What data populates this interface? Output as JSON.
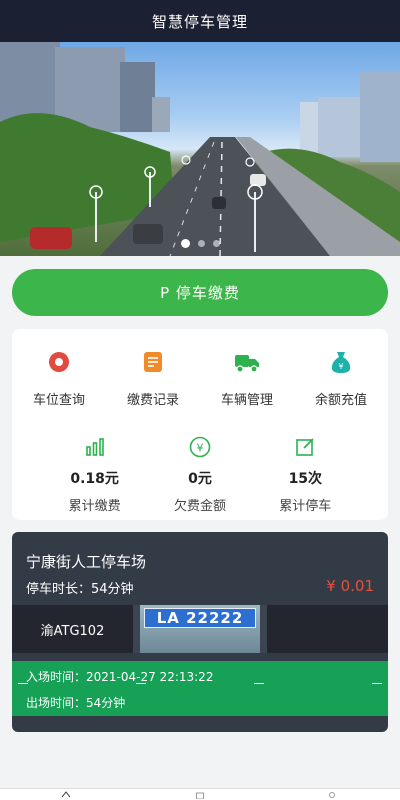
{
  "header": {
    "title": "智慧停车管理"
  },
  "banner": {
    "image": "city-road-streetlights-illustration",
    "slides": 3,
    "active_slide": 0
  },
  "pay_button": {
    "label": "P 停车缴费"
  },
  "menu": [
    {
      "label": "车位查询",
      "icon": "location-target-icon",
      "color": "#e04a3f"
    },
    {
      "label": "缴费记录",
      "icon": "receipt-icon",
      "color": "#f08b2a"
    },
    {
      "label": "车辆管理",
      "icon": "truck-icon",
      "color": "#2eb14e"
    },
    {
      "label": "余额充值",
      "icon": "money-bag-icon",
      "color": "#1bb3a9"
    }
  ],
  "stats": [
    {
      "value": "0.18元",
      "label": "累计缴费",
      "icon": "bar-chart-icon"
    },
    {
      "value": "0元",
      "label": "欠费金额",
      "icon": "yen-circle-icon"
    },
    {
      "value": "15次",
      "label": "累计停车",
      "icon": "edit-note-icon"
    }
  ],
  "parking": {
    "lot_name": "宁康街人工停车场",
    "duration": "停车时长：54分钟",
    "fee": "¥ 0.01",
    "plate_number": "渝ATG102",
    "plate_photo_text": "LA 22222",
    "entry_time": "入场时间：2021-04-27 22:13:22",
    "exit_time": "出场时间：54分钟"
  },
  "colors": {
    "accent_green": "#3cb54a",
    "header_bg": "#1c2033",
    "fee_red": "#e8503a",
    "time_bar": "#16a157"
  }
}
